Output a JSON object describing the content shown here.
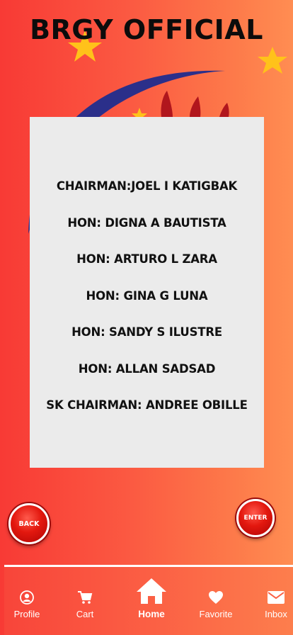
{
  "header": {
    "title": "BRGY OFFICIAL"
  },
  "officials": [
    "CHAIRMAN:JOEL I KATIGBAK",
    "HON: DIGNA A BAUTISTA",
    "HON: ARTURO L ZARA",
    "HON: GINA G LUNA",
    "HON: SANDY S ILUSTRE",
    "HON: ALLAN SADSAD",
    "SK CHAIRMAN: ANDREE OBILLE"
  ],
  "buttons": {
    "back": "BACK",
    "enter": "ENTER"
  },
  "nav": {
    "profile": "Profile",
    "cart": "Cart",
    "home": "Home",
    "favorite": "Favorite",
    "inbox": "Inbox"
  },
  "colors": {
    "background_start": "#f83a35",
    "background_end": "#ff8d52",
    "card": "#ebebeb",
    "logo_blue": "#2b2f8a",
    "star": "#ffc21a"
  }
}
